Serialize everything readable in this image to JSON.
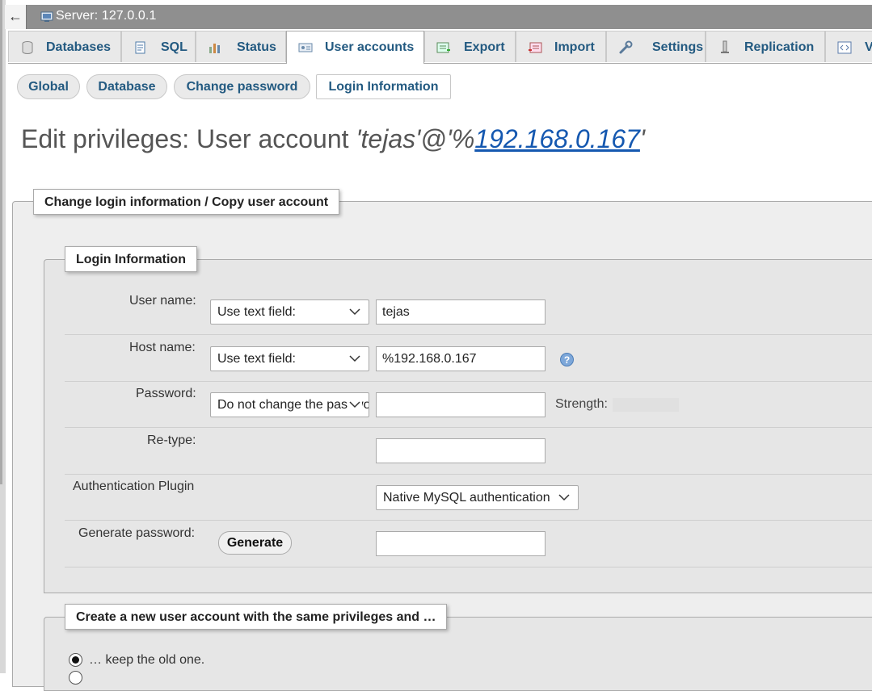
{
  "topbar": {
    "back_arrow": "←",
    "server_label": "Server: 127.0.0.1",
    "server_icon": "server-icon"
  },
  "tabs": [
    {
      "label": "Databases",
      "icon": "database-icon"
    },
    {
      "label": "SQL",
      "icon": "sql-icon"
    },
    {
      "label": "Status",
      "icon": "status-icon"
    },
    {
      "label": "User accounts",
      "icon": "user-accounts-icon",
      "active": true
    },
    {
      "label": "Export",
      "icon": "export-icon"
    },
    {
      "label": "Import",
      "icon": "import-icon"
    },
    {
      "label": "Settings",
      "icon": "wrench-icon"
    },
    {
      "label": "Replication",
      "icon": "replication-icon"
    },
    {
      "label": "V",
      "icon": "variables-icon"
    }
  ],
  "subtabs": [
    {
      "label": "Global"
    },
    {
      "label": "Database"
    },
    {
      "label": "Change password"
    },
    {
      "label": "Login Information",
      "active": true
    }
  ],
  "title": {
    "prefix": "Edit privileges: User account ",
    "user_part": "'tejas'@'%",
    "host_link": "192.168.0.167",
    "suffix": "'"
  },
  "fieldset_outer_legend": "Change login information / Copy user account",
  "login_info": {
    "legend": "Login Information",
    "user_name_label": "User name:",
    "user_name_select": "Use text field:",
    "user_name_value": "tejas",
    "host_name_label": "Host name:",
    "host_name_select": "Use text field:",
    "host_name_value": "%192.168.0.167",
    "password_label": "Password:",
    "password_select": "Do not change the password",
    "password_value": "",
    "strength_label": "Strength:",
    "retype_label": "Re-type:",
    "retype_value": "",
    "auth_plugin_label": "Authentication Plugin",
    "auth_plugin_select": "Native MySQL authentication",
    "generate_label": "Generate password:",
    "generate_button": "Generate",
    "generated_value": ""
  },
  "copy_section": {
    "legend": "Create a new user account with the same privileges and …",
    "option_keep": "… keep the old one."
  },
  "colors": {
    "link": "#235a81",
    "topbar": "#8f8f8f",
    "fieldset_bg": "#eeeeee"
  }
}
